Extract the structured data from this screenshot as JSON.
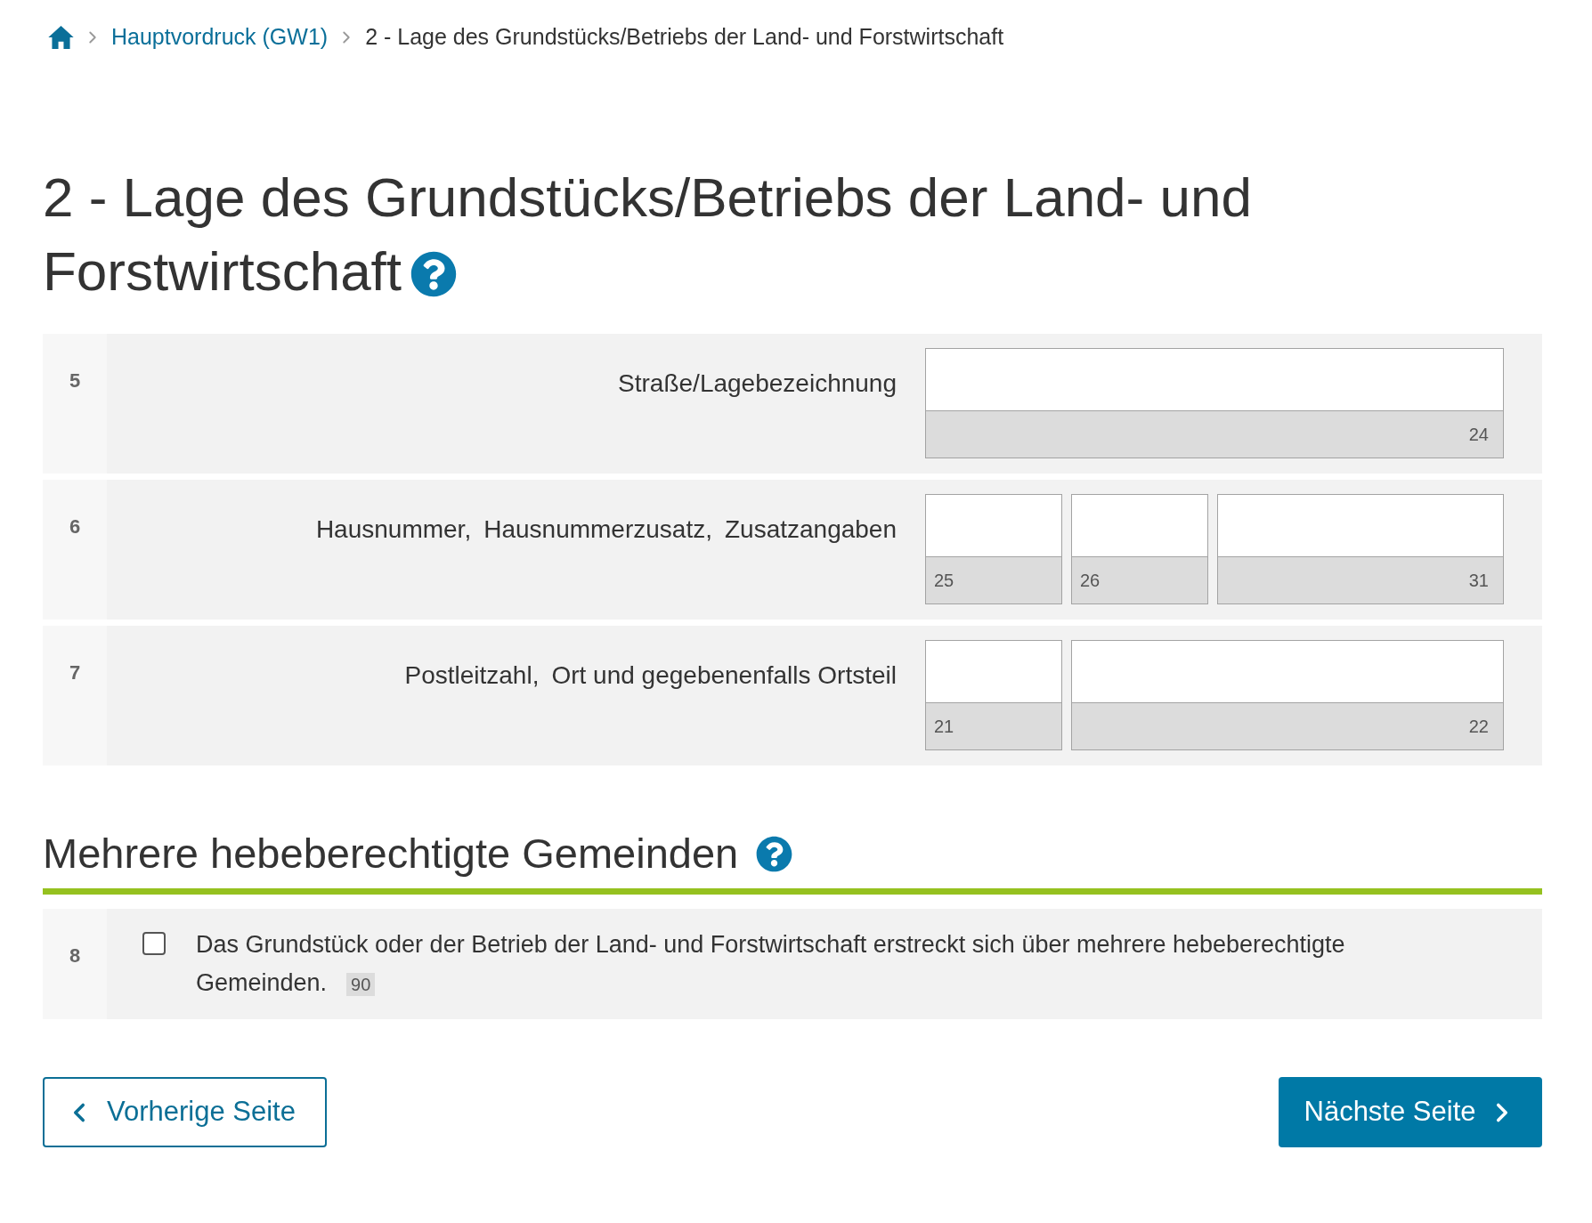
{
  "breadcrumb": [
    {
      "label": "Hauptvordruck (GW1)",
      "kind": "link"
    },
    {
      "label": "2 - Lage des Grundstücks/Betriebs der Land- und Forstwirtschaft",
      "kind": "current"
    }
  ],
  "title": "2 - Lage des Grundstücks/Betriebs der Land- und Forstwirtschaft",
  "rows": [
    {
      "number": "5",
      "labels": [
        "Straße/Lagebezeichnung"
      ],
      "fields": [
        {
          "code": "24",
          "kind": "long"
        }
      ]
    },
    {
      "number": "6",
      "labels": [
        "Hausnummer,",
        "Hausnummerzusatz,",
        "Zusatzangaben"
      ],
      "fields": [
        {
          "code": "25",
          "kind": "short"
        },
        {
          "code": "26",
          "kind": "short"
        },
        {
          "code": "31",
          "kind": "long"
        }
      ]
    },
    {
      "number": "7",
      "labels": [
        "Postleitzahl,",
        "Ort und gegebenenfalls Ortsteil"
      ],
      "fields": [
        {
          "code": "21",
          "kind": "short"
        },
        {
          "code": "22",
          "kind": "long"
        }
      ]
    }
  ],
  "section": {
    "title": "Mehrere hebeberechtigte Gemeinden",
    "rows": [
      {
        "number": "8",
        "text": "Das Grundstück oder der Betrieb der Land- und Forstwirtschaft erstreckt sich über mehrere hebeberechtigte Gemeinden.",
        "code": "90",
        "checked": false
      }
    ]
  },
  "buttons": [
    {
      "label": "Vorherige Seite",
      "kind": "previous"
    },
    {
      "label": "Nächste Seite",
      "kind": "next"
    }
  ]
}
